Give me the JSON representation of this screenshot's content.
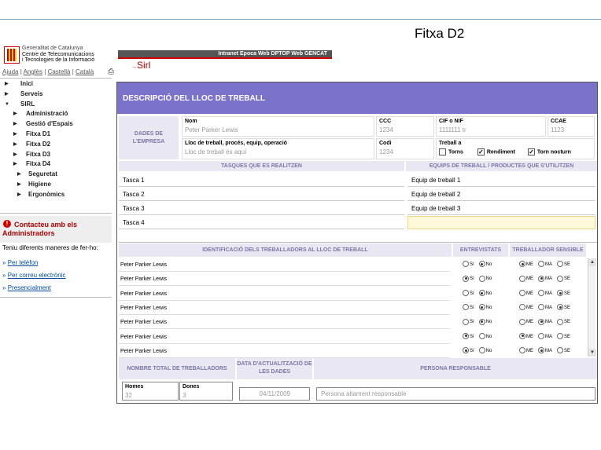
{
  "slide_title": "Fitxa D2",
  "org": {
    "line1": "Generalitat de Catalunya",
    "line2": "Centre de Telecomunicacions",
    "line3": "i Tecnologies de la Informació"
  },
  "lang": {
    "help": "Ajuda",
    "sep": "|",
    "english": "Anglès",
    "spanish": "Castellà",
    "catalan": "Català"
  },
  "nav": [
    "Inici",
    "Serveis",
    "SIRL",
    "Administració",
    "Gestió d'Espais",
    "Fitxa D1",
    "Fitxa D2",
    "Fitxa D3",
    "Fitxa D4",
    "Seguretat",
    "Higiene",
    "Ergonòmics"
  ],
  "contact": {
    "title": "Contacteu amb els Administradors",
    "intro": "Teniu diferents maneres de fer-ho:",
    "links": [
      "Per telèfon",
      "Per correu electrònic",
      "Presencialment"
    ],
    "bullet": "»"
  },
  "topnav": "Intranet  Epoca  Web DPTOP  Web GENCAT",
  "app_name": "Sirl",
  "form": {
    "title": "DESCRIPCIÓ DEL LLOC DE TREBALL",
    "company_label": "DADES DE L'EMPRESA",
    "fields": {
      "nom_label": "Nom",
      "nom_value": "Peter Parker Lewis",
      "ccc_label": "CCC",
      "ccc_value": "1234",
      "cif_label": "CIF o NIF",
      "cif_value": "1111111 tr",
      "ccae_label": "CCAE",
      "ccae_value": "1123",
      "lloc_label": "Lloc de treball, procés, equip, operació",
      "lloc_value": "Lloc de treball és aquí",
      "codi_label": "Codi",
      "codi_value": "1234",
      "treball_label": "Treball a",
      "torns": "Torns",
      "rendiment": "Rendiment",
      "torn_nocturn": "Torn nocturn"
    },
    "checks": {
      "torns": false,
      "rendiment": true,
      "torn_nocturn": true
    },
    "tasks_header": "TASQUES QUE ES REALITZEN",
    "equips_header": "EQUIPS DE TREBALL / PRODUCTES QUE S'UTILITZEN",
    "tasks": [
      "Tasca 1",
      "Tasca 2",
      "Tasca 3",
      "Tasca 4"
    ],
    "equips": [
      "Equip de treball 1",
      "Equip de treball 2",
      "Equip de treball 3",
      ""
    ],
    "workers_header": "IDENTIFICACIÓ DELS TREBALLADORS AL LLOC DE TREBALL",
    "entrevistats_header": "ENTREVISTATS",
    "sensible_header": "TREBALLADOR SENSIBLE",
    "opt_si": "Sí",
    "opt_no": "No",
    "opt_me": "ME",
    "opt_ma": "MA",
    "opt_se": "SE",
    "workers": [
      {
        "name": "Peter Parker Lewis",
        "entrevistat": "No",
        "sensible": "ME"
      },
      {
        "name": "Peter Parker Lewis",
        "entrevistat": "Sí",
        "sensible": "MA"
      },
      {
        "name": "Peter Parker Lewis",
        "entrevistat": "No",
        "sensible": "SE"
      },
      {
        "name": "Peter Parker Lewis",
        "entrevistat": "No",
        "sensible": "SE"
      },
      {
        "name": "Peter Parker Lewis",
        "entrevistat": "No",
        "sensible": "MA"
      },
      {
        "name": "Peter Parker Lewis",
        "entrevistat": "Sí",
        "sensible": "ME"
      },
      {
        "name": "Peter Parker Lewis",
        "entrevistat": "Sí",
        "sensible": "MA"
      }
    ],
    "total_header": "NOMBRE TOTAL DE TREBALLADORS",
    "homes_label": "Homes",
    "homes_value": "32",
    "dones_label": "Dones",
    "dones_value": "3",
    "data_header": "DATA D'ACTUALITZACIÓ DE LES DADES",
    "data_value": "04/11/2009",
    "responsable_header": "PERSONA RESPONSABLE",
    "responsable_value": "Persona altament responsable"
  }
}
